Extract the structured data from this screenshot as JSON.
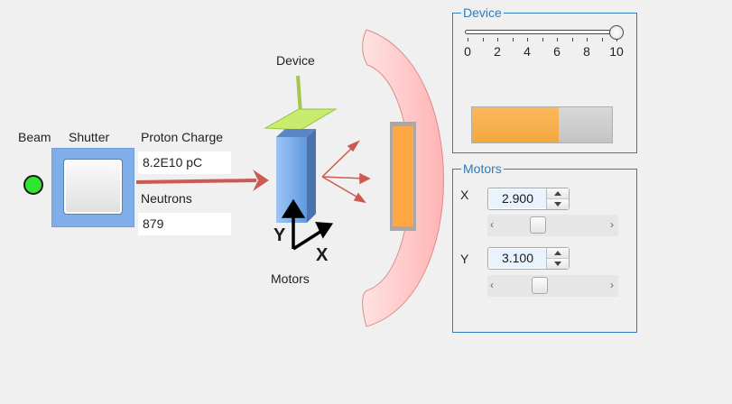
{
  "beam": {
    "label": "Beam",
    "led_color": "#2fe52f"
  },
  "shutter": {
    "label": "Shutter"
  },
  "proton_charge": {
    "label": "Proton Charge",
    "value": "8.2E10 pC"
  },
  "neutrons": {
    "label": "Neutrons",
    "value": "879"
  },
  "diagram": {
    "device_label": "Device",
    "motors_label": "Motors",
    "axis_y": "Y",
    "axis_x": "X"
  },
  "device_panel": {
    "title": "Device",
    "slider": {
      "min": 0,
      "max": 10,
      "value": 10,
      "tick_labels": [
        "0",
        "2",
        "4",
        "6",
        "8",
        "10"
      ]
    },
    "progress_fraction": 0.62
  },
  "motors_panel": {
    "title": "Motors",
    "x": {
      "label": "X",
      "value": "2.900",
      "scroll_fraction": 0.29
    },
    "y": {
      "label": "Y",
      "value": "3.100",
      "scroll_fraction": 0.31
    }
  },
  "colors": {
    "accent": "#2e7bbd",
    "beam_arrow": "#cc5a52",
    "detector": "#ffa745",
    "sample": "#77adf0",
    "progress": "#f4a73f"
  }
}
